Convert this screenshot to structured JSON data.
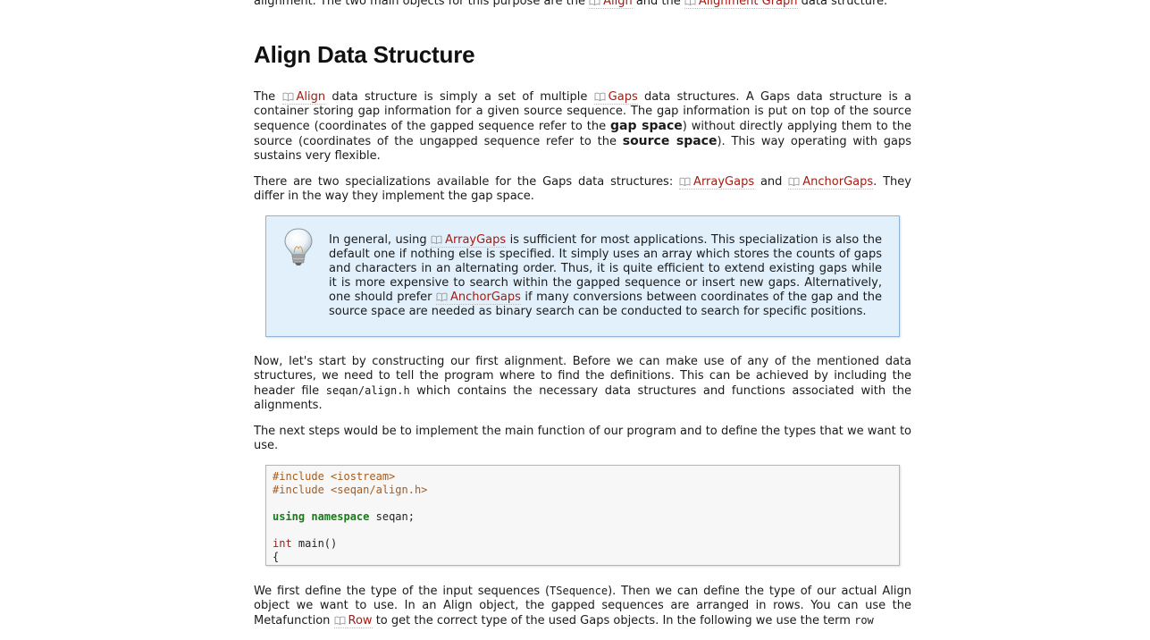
{
  "intro": {
    "text1": "alignment. The two main objects for this purpose are the ",
    "link1": "Align",
    "text2": " and the ",
    "link2": "Alignment Graph",
    "text3": " data structure."
  },
  "section": {
    "title": "Align Data Structure"
  },
  "para1": {
    "t1": "The ",
    "link_align": "Align",
    "t2": " data structure is simply a set of multiple ",
    "link_gaps": "Gaps",
    "t3": " data structures. A Gaps data structure is a container storing gap information for a given source sequence. The gap information is put on top of the source sequence (coordinates of the gapped sequence refer to the ",
    "term_gap_space": "gap space",
    "t4": ") without directly applying them to the source (coordinates of the ungapped sequence refer to the ",
    "term_source_space": "source space",
    "t5": "). This way operating with gaps sustains very flexible."
  },
  "para2": {
    "t1": "There are two specializations available for the Gaps data structures: ",
    "link_array": "ArrayGaps",
    "t2": " and ",
    "link_anchor": "AnchorGaps",
    "t3": ". They differ in the way they implement the gap space."
  },
  "tip": {
    "icon": "lightbulb-icon",
    "t1": "In general, using ",
    "link_array": "ArrayGaps",
    "t2": " is sufficient for most applications. This specialization is also the default one if nothing else is specified. It simply uses an array which stores the counts of gaps and characters in an alternating order. Thus, it is quite efficient to extend existing gaps while it is more expensive to search within the gapped sequence or insert new gaps. Alternatively, one should prefer ",
    "link_anchor": "AnchorGaps",
    "t3": " if many conversions between coordinates of the gap and the source space are needed as binary search can be conducted to search for specific positions."
  },
  "para3": {
    "t1": "Now, let's start by constructing our first alignment. Before we can make use of any of the mentioned data structures, we need to tell the program where to find the definitions. This can be achieved by including the header file ",
    "code": "seqan/align.h",
    "t2": " which contains the necessary data structures and functions associated with the alignments."
  },
  "para4": {
    "text": "The next steps would be to implement the main function of our program and to define the types that we want to use."
  },
  "code_block": {
    "inc1": "#include <iostream>",
    "inc2": "#include <seqan/align.h>",
    "kw_using": "using",
    "kw_namespace": "namespace",
    "ns": " seqan;",
    "kw_int": "int",
    "main": " main()",
    "brace": "{"
  },
  "para5": {
    "t1": "We first define the type of the input sequences (",
    "code1": "TSequence",
    "t2": "). Then we can define the type of our actual Align object we want to use. In an Align object, the gapped sequences are arranged in rows. You can use the Metafunction ",
    "link_row": "Row",
    "t3": " to get the correct type of the used Gaps objects. In the following we use the term ",
    "code2": "row"
  },
  "colors": {
    "link": "#a51b12",
    "tip_bg": "#e1f0fa",
    "tip_border": "#8fb4d6",
    "code_bg": "#f7f7f7",
    "keyword": "#1a7a1a",
    "preprocessor": "#a65c1c"
  }
}
